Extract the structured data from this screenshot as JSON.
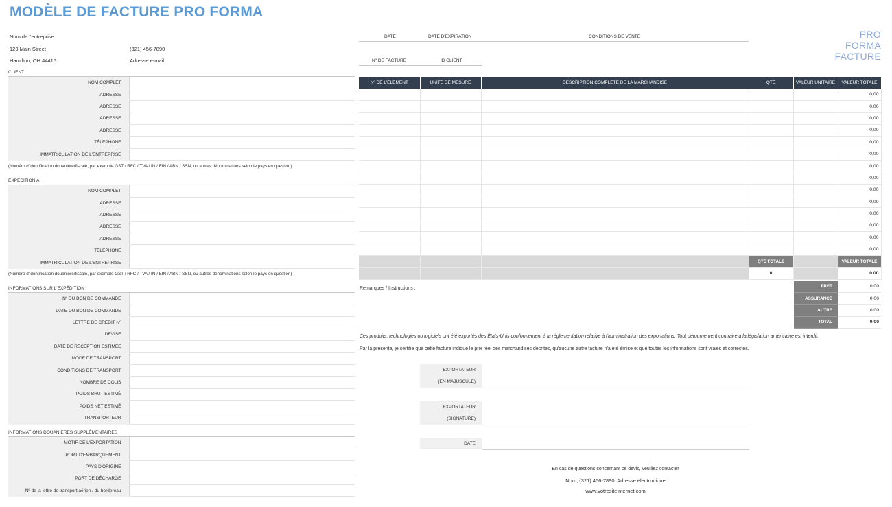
{
  "title": "MODÈLE DE FACTURE PRO FORMA",
  "company": {
    "name": "Nom de l'entreprise",
    "street": "123 Main Street",
    "city": "Hamilton, OH 44416",
    "phone": "(321) 456-7890",
    "email": "Adresse e-mail"
  },
  "header_fields": {
    "date": "DATE",
    "expiration": "DATE D'EXPIRATION",
    "conditions": "CONDITIONS DE VENTE",
    "invoice_no": "Nº DE FACTURE",
    "client_id": "ID CLIENT"
  },
  "pro_forma": [
    "PRO",
    "FORMA",
    "FACTURE"
  ],
  "client": {
    "heading": "CLIENT",
    "rows": [
      "NOM COMPLET",
      "ADRESSE",
      "ADRESSE",
      "ADRESSE",
      "ADRESSE",
      "TÉLÉPHONE",
      "IMMATRICULATION DE L'ENTREPRISE"
    ]
  },
  "tax_note": "(Numéro d'identification douanière/fiscale, par exemple GST / RFC / TVA / IN / EIN / ABN / SSN, ou autres dénominations selon le pays en question)",
  "shipping": {
    "heading": "EXPÉDITION À",
    "rows": [
      "NOM COMPLET",
      "ADRESSE",
      "ADRESSE",
      "ADRESSE",
      "ADRESSE",
      "TÉLÉPHONE",
      "IMMATRICULATION DE L'ENTREPRISE"
    ]
  },
  "shipment_info": {
    "heading": "INFORMATIONS SUR L'EXPÉDITION",
    "rows": [
      "Nº DU BON DE COMMANDE",
      "DATE DU BON DE COMMANDE",
      "LETTRE DE CRÉDIT Nº",
      "DEVISE",
      "DATE DE RÉCEPTION ESTIMÉE",
      "MODE DE TRANSPORT",
      "CONDITIONS DE TRANSPORT",
      "NOMBRE DE COLIS",
      "POIDS BRUT ESTIMÉ",
      "POIDS NET ESTIMÉ",
      "TRANSPORTEUR"
    ]
  },
  "customs_info": {
    "heading": "INFORMATIONS DOUANIÈRES SUPPLÉMENTAIRES",
    "rows": [
      "MOTIF DE L'EXPORTATION",
      "PORT D'EMBARQUEMENT",
      "PAYS D'ORIGINE",
      "PORT DE DÉCHARGE",
      "Nº de la lettre de transport aérien / du bordereau"
    ]
  },
  "items_table": {
    "headers": [
      "Nº DE L'ÉLÉMENT",
      "UNITÉ DE MESURE",
      "DESCRIPTION COMPLÈTE DE LA MARCHANDISE",
      "QTÉ",
      "VALEUR UNITAIRE",
      "VALEUR TOTALE"
    ],
    "row_totals": [
      "0,00",
      "0,00",
      "0,00",
      "0,00",
      "0,00",
      "0,00",
      "0,00",
      "0,00",
      "0,00",
      "0,00",
      "0,00",
      "0,00",
      "0,00",
      "0,00"
    ],
    "total_qty_label": "QTÉ TOTALE",
    "total_value_label": "VALEUR TOTALE",
    "total_qty": "0",
    "total_value": "0.00"
  },
  "remarks_label": "Remarques / Instructions :",
  "totals": [
    {
      "label": "FRET",
      "value": "0,00"
    },
    {
      "label": "ASSURANCE",
      "value": "0,00"
    },
    {
      "label": "AUTRE",
      "value": "0,00"
    },
    {
      "label": "TOTAL",
      "value": "0.00"
    }
  ],
  "export_notice": "Ces produits, technologies ou logiciels ont été exportés des États-Unis conformément à la réglementation relative à l'administration des exportations.  Tout détournement contraire à la législation américaine est interdit.",
  "certify_text": "Par la présente, je certifie que cette facture indique le prix réel des marchandises décrites, qu'aucune autre facture n'a été émise et que toutes les informations sont vraies et correctes.",
  "signature": {
    "exporter1_a": "EXPORTATEUR",
    "exporter1_b": "(EN MAJUSCULE)",
    "exporter2_a": "EXPORTATEUR",
    "exporter2_b": "(SIGNATURE)",
    "date": "DATE"
  },
  "contact": {
    "line1": "En cas de questions concernant ce devis, veuillez contacter",
    "line2": "Nom, (321) 456-7890, Adresse électronique",
    "line3": "www.votresiteinternet.com"
  }
}
